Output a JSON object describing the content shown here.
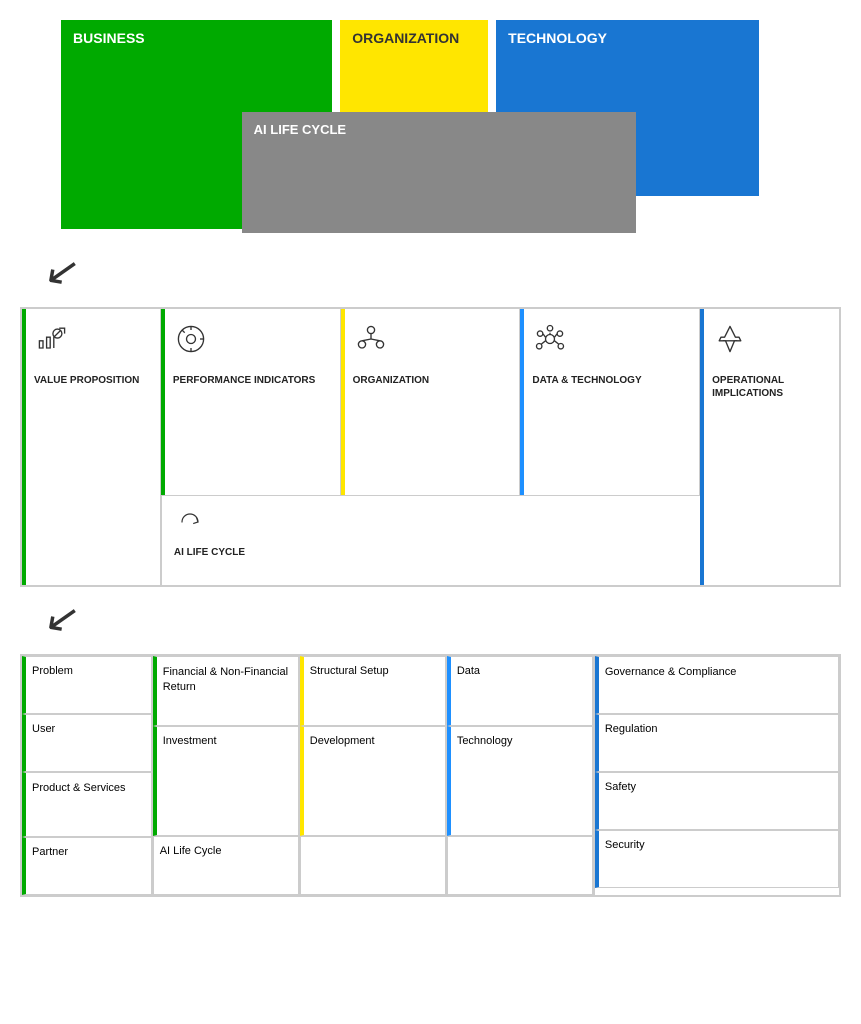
{
  "top": {
    "business_label": "BUSINESS",
    "organization_label": "ORGANIZATION",
    "technology_label": "TECHNOLOGY",
    "ai_lifecycle_label": "AI LIFE CYCLE"
  },
  "mid": {
    "value_proposition": "VALUE PROPOSITION",
    "performance_indicators": "PERFORMANCE INDICATORS",
    "organization": "ORGANIZATION",
    "data_technology": "DATA & TECHNOLOGY",
    "operational_implications": "OPERATIONAL IMPLICATIONS",
    "ai_lifecycle": "AI LIFE CYCLE"
  },
  "bottom": {
    "col1": {
      "items": [
        "Problem",
        "User",
        "Product & Services",
        "Partner"
      ]
    },
    "col2": {
      "items": [
        "Financial & Non-Financial Return",
        "Investment"
      ],
      "ai_lifecycle": "AI Life Cycle"
    },
    "col3": {
      "items": [
        "Structural Setup",
        "Development"
      ]
    },
    "col4": {
      "items": [
        "Data",
        "Technology"
      ]
    },
    "col5": {
      "items": [
        "Governance & Compliance",
        "Regulation",
        "Safety",
        "Security"
      ]
    }
  },
  "arrows": {
    "down1": "↙",
    "down2": "↙"
  }
}
